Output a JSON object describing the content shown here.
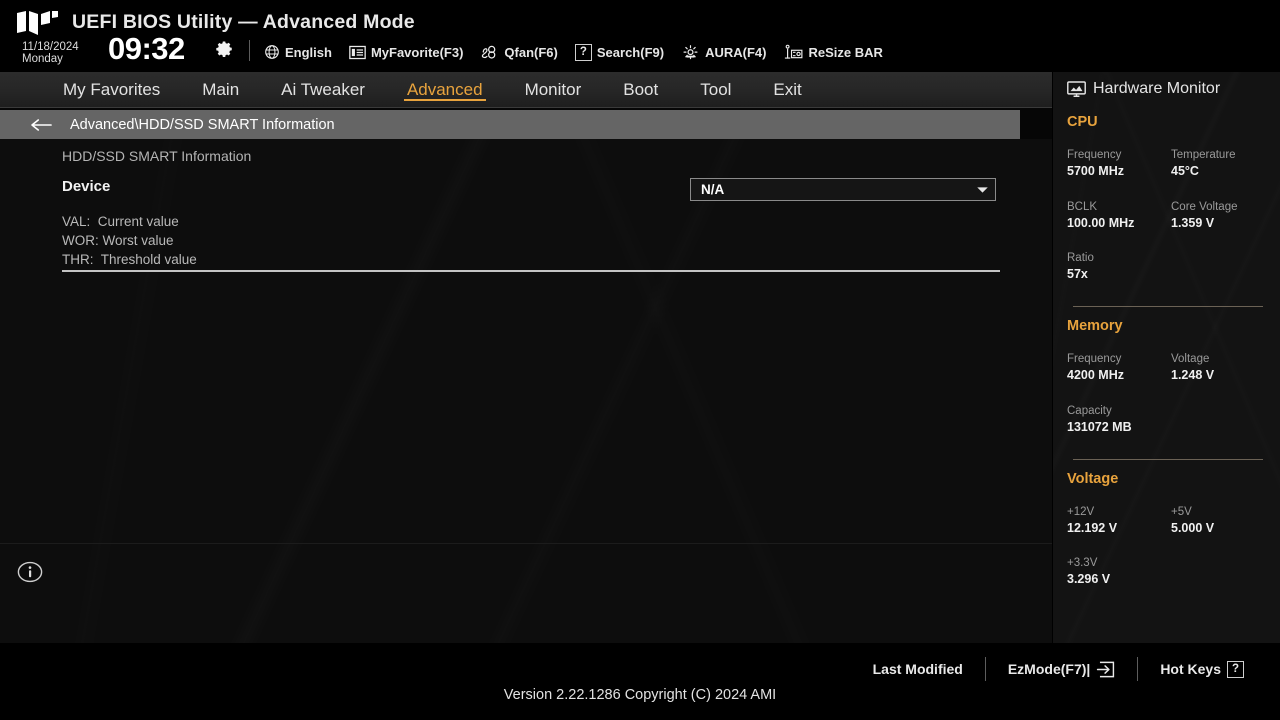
{
  "header": {
    "title": "UEFI BIOS Utility — Advanced Mode",
    "logo_icon": "tuf-logo-icon",
    "date": "11/18/2024",
    "weekday": "Monday",
    "time": "09:32",
    "gear_icon": "gear-icon",
    "tools": [
      {
        "label": "English",
        "icon": "globe-icon"
      },
      {
        "label": "MyFavorite(F3)",
        "icon": "favorites-list-icon"
      },
      {
        "label": "Qfan(F6)",
        "icon": "fan-icon"
      },
      {
        "label": "Search(F9)",
        "icon": "question-box-icon"
      },
      {
        "label": "AURA(F4)",
        "icon": "aura-light-icon"
      },
      {
        "label": "ReSize BAR",
        "icon": "resize-bar-icon"
      }
    ]
  },
  "nav": {
    "tabs": [
      {
        "label": "My Favorites",
        "active": false
      },
      {
        "label": "Main",
        "active": false
      },
      {
        "label": "Ai Tweaker",
        "active": false
      },
      {
        "label": "Advanced",
        "active": true
      },
      {
        "label": "Monitor",
        "active": false
      },
      {
        "label": "Boot",
        "active": false
      },
      {
        "label": "Tool",
        "active": false
      },
      {
        "label": "Exit",
        "active": false
      }
    ],
    "accent_color": "#e8a33d"
  },
  "breadcrumb": {
    "back_icon": "back-arrow-icon",
    "path": "Advanced\\HDD/SSD SMART Information"
  },
  "main": {
    "section_title": "HDD/SSD SMART Information",
    "device_label": "Device",
    "device_value": "N/A",
    "device_chevron_icon": "chevron-down-icon",
    "legend": [
      "VAL:  Current value",
      "WOR: Worst value",
      "THR:  Threshold value"
    ],
    "info_icon": "info-circle-icon"
  },
  "hardware_monitor": {
    "title": "Hardware Monitor",
    "title_icon": "monitor-icon",
    "groups": [
      {
        "name": "CPU",
        "rows": [
          [
            {
              "key": "Frequency",
              "value": "5700 MHz"
            },
            {
              "key": "Temperature",
              "value": "45°C"
            }
          ],
          [
            {
              "key": "BCLK",
              "value": "100.00 MHz"
            },
            {
              "key": "Core Voltage",
              "value": "1.359 V"
            }
          ],
          [
            {
              "key": "Ratio",
              "value": "57x"
            }
          ]
        ]
      },
      {
        "name": "Memory",
        "rows": [
          [
            {
              "key": "Frequency",
              "value": "4200 MHz"
            },
            {
              "key": "Voltage",
              "value": "1.248 V"
            }
          ],
          [
            {
              "key": "Capacity",
              "value": "131072 MB"
            }
          ]
        ]
      },
      {
        "name": "Voltage",
        "rows": [
          [
            {
              "key": "+12V",
              "value": "12.192 V"
            },
            {
              "key": "+5V",
              "value": "5.000 V"
            }
          ],
          [
            {
              "key": "+3.3V",
              "value": "3.296 V"
            }
          ]
        ]
      }
    ]
  },
  "footer": {
    "last_modified": "Last Modified",
    "ezmode": "EzMode(F7)|",
    "ezmode_icon": "exit-arrow-icon",
    "hotkeys": "Hot Keys",
    "hotkeys_key": "?",
    "version": "Version 2.22.1286 Copyright (C) 2024 AMI"
  }
}
